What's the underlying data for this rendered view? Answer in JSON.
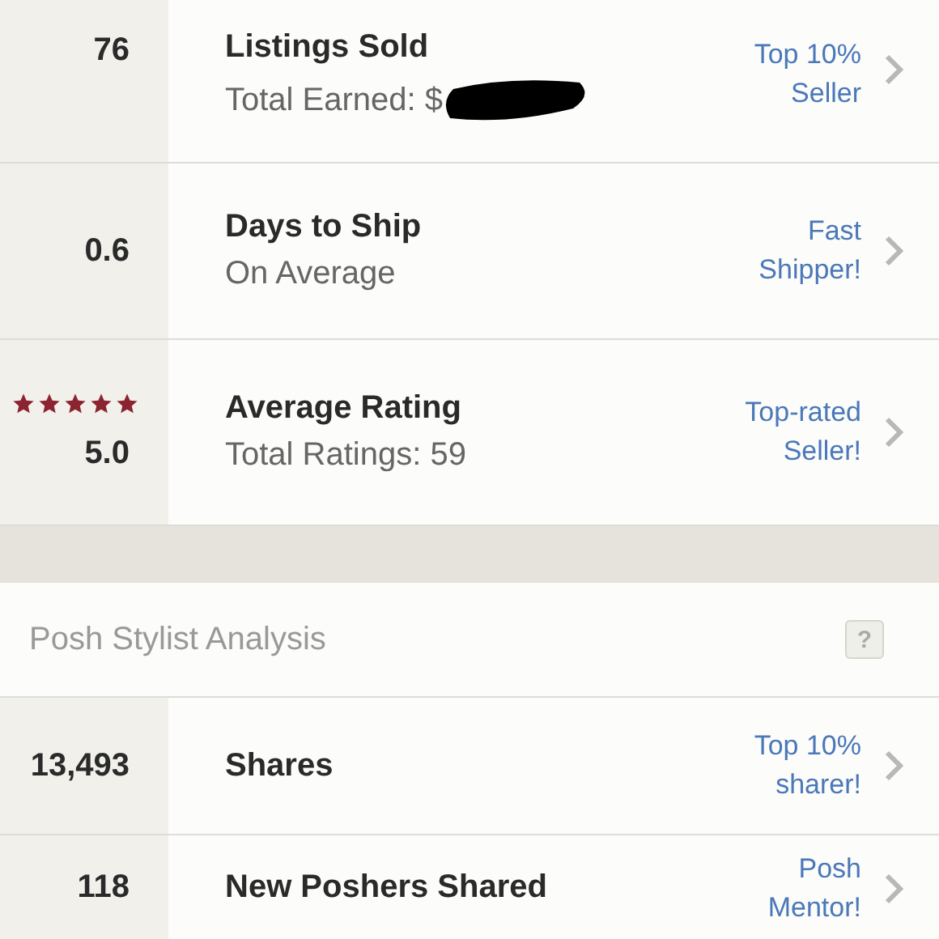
{
  "stats": [
    {
      "value": "76",
      "title": "Listings Sold",
      "subtitle": "Total Earned: $",
      "redacted": true,
      "badge": "Top 10% Seller"
    },
    {
      "value": "0.6",
      "title": "Days to Ship",
      "subtitle": "On Average",
      "badge": "Fast Shipper!"
    },
    {
      "value": "5.0",
      "stars": 5,
      "title": "Average Rating",
      "subtitle": "Total Ratings: 59",
      "badge": "Top-rated Seller!"
    }
  ],
  "section": {
    "title": "Posh Stylist Analysis",
    "help": "?"
  },
  "stylist": [
    {
      "value": "13,493",
      "title": "Shares",
      "badge": "Top 10% sharer!"
    },
    {
      "value": "118",
      "title": "New Poshers Shared",
      "badge": "Posh Mentor!"
    }
  ]
}
